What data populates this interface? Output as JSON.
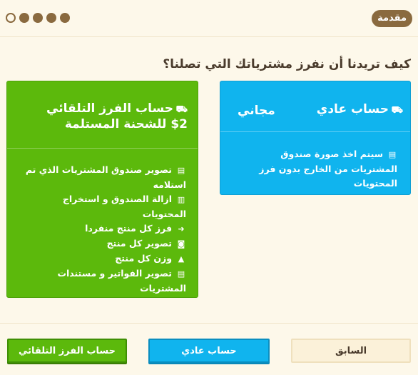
{
  "header": {
    "badge": "مقدمة",
    "steps": [
      {
        "state": "active"
      },
      {
        "state": "done"
      },
      {
        "state": "done"
      },
      {
        "state": "done"
      },
      {
        "state": "done"
      }
    ]
  },
  "question": "كيف تريدنا أن نفرز مشترياتك التي تصلنا؟",
  "normal_card": {
    "icon": "truck-icon",
    "title": "حساب عادي",
    "price": "مجاني",
    "description_icon": "document-icon",
    "description": "سيتم اخذ صورة صندوق المشتريات من الخارج بدون فرز المحتويات"
  },
  "auto_card": {
    "icon": "truck-icon",
    "title": "حساب الفرز التلقائي",
    "price": "$2 للشحنة المستلمة",
    "features": [
      {
        "icon": "document-icon",
        "glyph": "▤",
        "text": "تصوير صندوق المشتريات الذي تم استلامه"
      },
      {
        "icon": "trash-icon",
        "glyph": "▥",
        "text": "ازالة الصندوق و استخراج المحتويات"
      },
      {
        "icon": "arrow-right-icon",
        "glyph": "➜",
        "text": "فرز كل منتج منفردا"
      },
      {
        "icon": "camera-icon",
        "glyph": "◙",
        "text": "تصوير كل منتج"
      },
      {
        "icon": "scale-icon",
        "glyph": "▲",
        "text": "وزن كل منتج"
      },
      {
        "icon": "file-icon",
        "glyph": "▤",
        "text": "تصوير الفواتير و مستندات المشتريات"
      }
    ]
  },
  "footer": {
    "prev_label": "السابق",
    "normal_label": "حساب عادي",
    "auto_label": "حساب الفرز التلقائي"
  },
  "colors": {
    "background": "#fdf8ea",
    "brown": "#8a6a3f",
    "blue": "#10b4ee",
    "green": "#5cb90c"
  }
}
